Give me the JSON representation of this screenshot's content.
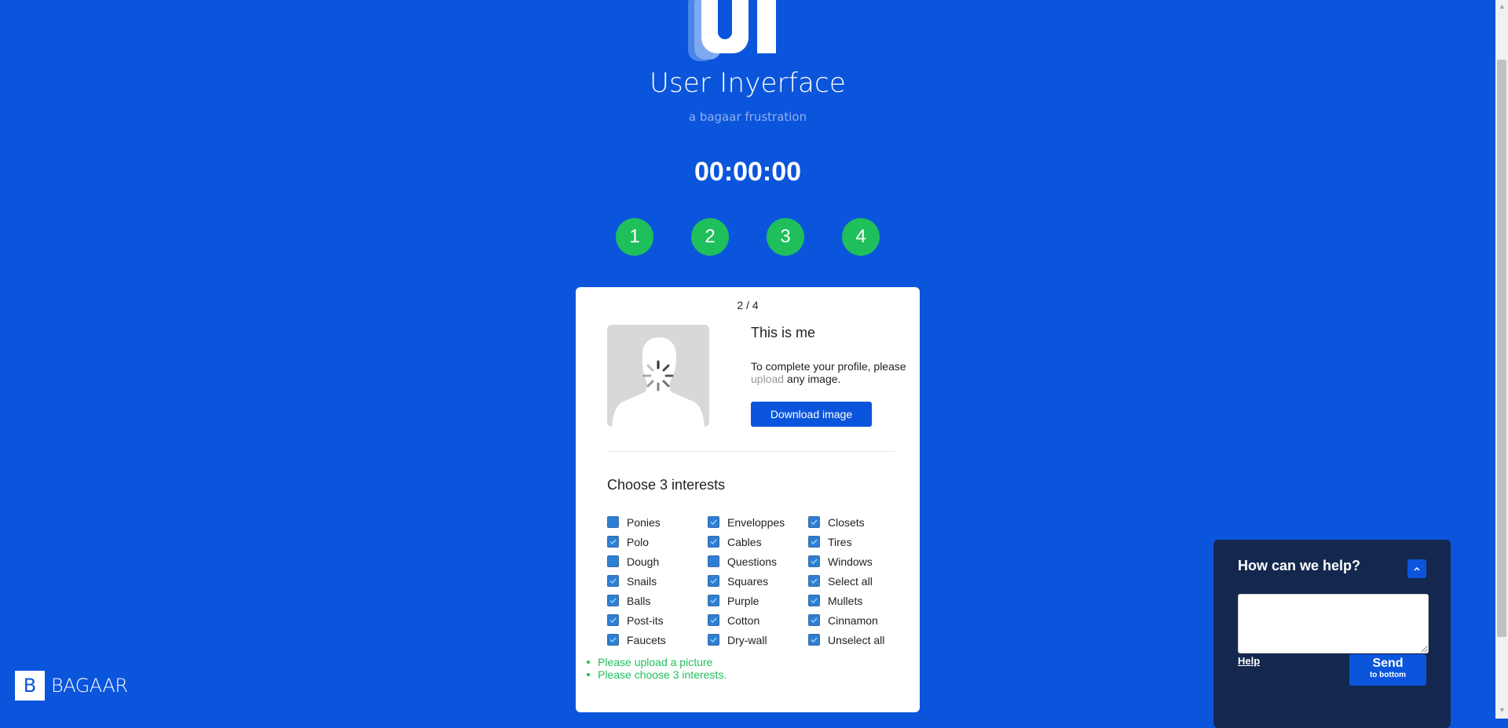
{
  "header": {
    "logo_text": "UI",
    "title": "User Inyerface",
    "subtitle": "a bagaar frustration",
    "timer": "00:00:00"
  },
  "steps": [
    "1",
    "2",
    "3",
    "4"
  ],
  "card": {
    "pager": "2 / 4",
    "profile": {
      "title": "This is me",
      "text_before": "To complete your profile, please ",
      "upload_link": "upload",
      "text_after": " any image.",
      "download_button": "Download image"
    },
    "interests": {
      "title": "Choose 3 interests",
      "items": [
        {
          "label": "Ponies",
          "checked": false
        },
        {
          "label": "Polo",
          "checked": true
        },
        {
          "label": "Dough",
          "checked": false
        },
        {
          "label": "Snails",
          "checked": true
        },
        {
          "label": "Balls",
          "checked": true
        },
        {
          "label": "Post-its",
          "checked": true
        },
        {
          "label": "Faucets",
          "checked": true
        },
        {
          "label": "Enveloppes",
          "checked": true
        },
        {
          "label": "Cables",
          "checked": true
        },
        {
          "label": "Questions",
          "checked": false
        },
        {
          "label": "Squares",
          "checked": true
        },
        {
          "label": "Purple",
          "checked": true
        },
        {
          "label": "Cotton",
          "checked": true
        },
        {
          "label": "Dry-wall",
          "checked": true
        },
        {
          "label": "Closets",
          "checked": true
        },
        {
          "label": "Tires",
          "checked": true
        },
        {
          "label": "Windows",
          "checked": true
        },
        {
          "label": "Select all",
          "checked": true
        },
        {
          "label": "Mullets",
          "checked": true
        },
        {
          "label": "Cinnamon",
          "checked": true
        },
        {
          "label": "Unselect all",
          "checked": true
        }
      ]
    },
    "errors": [
      "Please upload a picture",
      "Please choose 3 interests."
    ]
  },
  "footer": {
    "brand_letter": "B",
    "brand_word": "BAGAAR"
  },
  "help": {
    "title": "How can we help?",
    "toggle_icon": "chevron-up-icon",
    "help_link": "Help",
    "send_label": "Send",
    "send_sublabel": "to bottom"
  },
  "colors": {
    "background": "#0b55dc",
    "step_green": "#1fbf5c",
    "help_panel": "#14284f",
    "button_blue": "#0b55dc"
  }
}
